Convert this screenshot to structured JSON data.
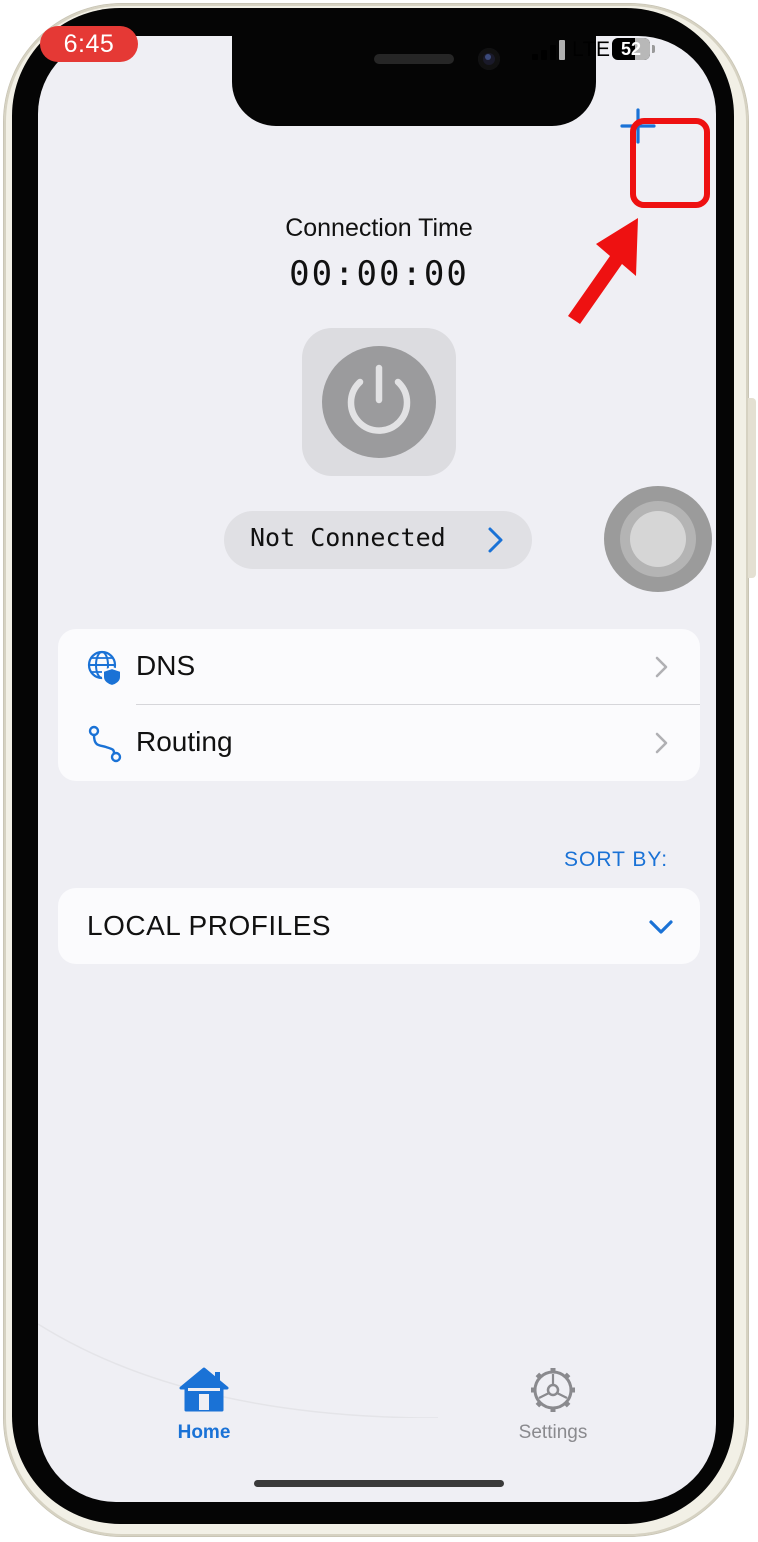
{
  "status_bar": {
    "time": "6:45",
    "network": "LTE",
    "battery": "52",
    "icons": [
      "signal-bars-icon",
      "battery-icon"
    ]
  },
  "toolbar": {
    "add_icon": "plus-icon"
  },
  "connection": {
    "label": "Connection Time",
    "time": "00:00:00",
    "power_icon": "power-icon",
    "status": "Not Connected"
  },
  "settings_list": [
    {
      "label": "DNS",
      "icon": "globe-shield-icon"
    },
    {
      "label": "Routing",
      "icon": "route-icon"
    }
  ],
  "sort_by": "SORT BY:",
  "profiles": {
    "label": "LOCAL PROFILES",
    "icon": "chevron-down-icon"
  },
  "tab_bar": {
    "tabs": [
      {
        "label": "Home",
        "icon": "house-icon",
        "active": true
      },
      {
        "label": "Settings",
        "icon": "gear-icon",
        "active": false
      }
    ]
  },
  "colors": {
    "accent": "#1a72d6",
    "annotation": "#ee1111",
    "time_badge": "#e53935",
    "background": "#efeff4"
  }
}
